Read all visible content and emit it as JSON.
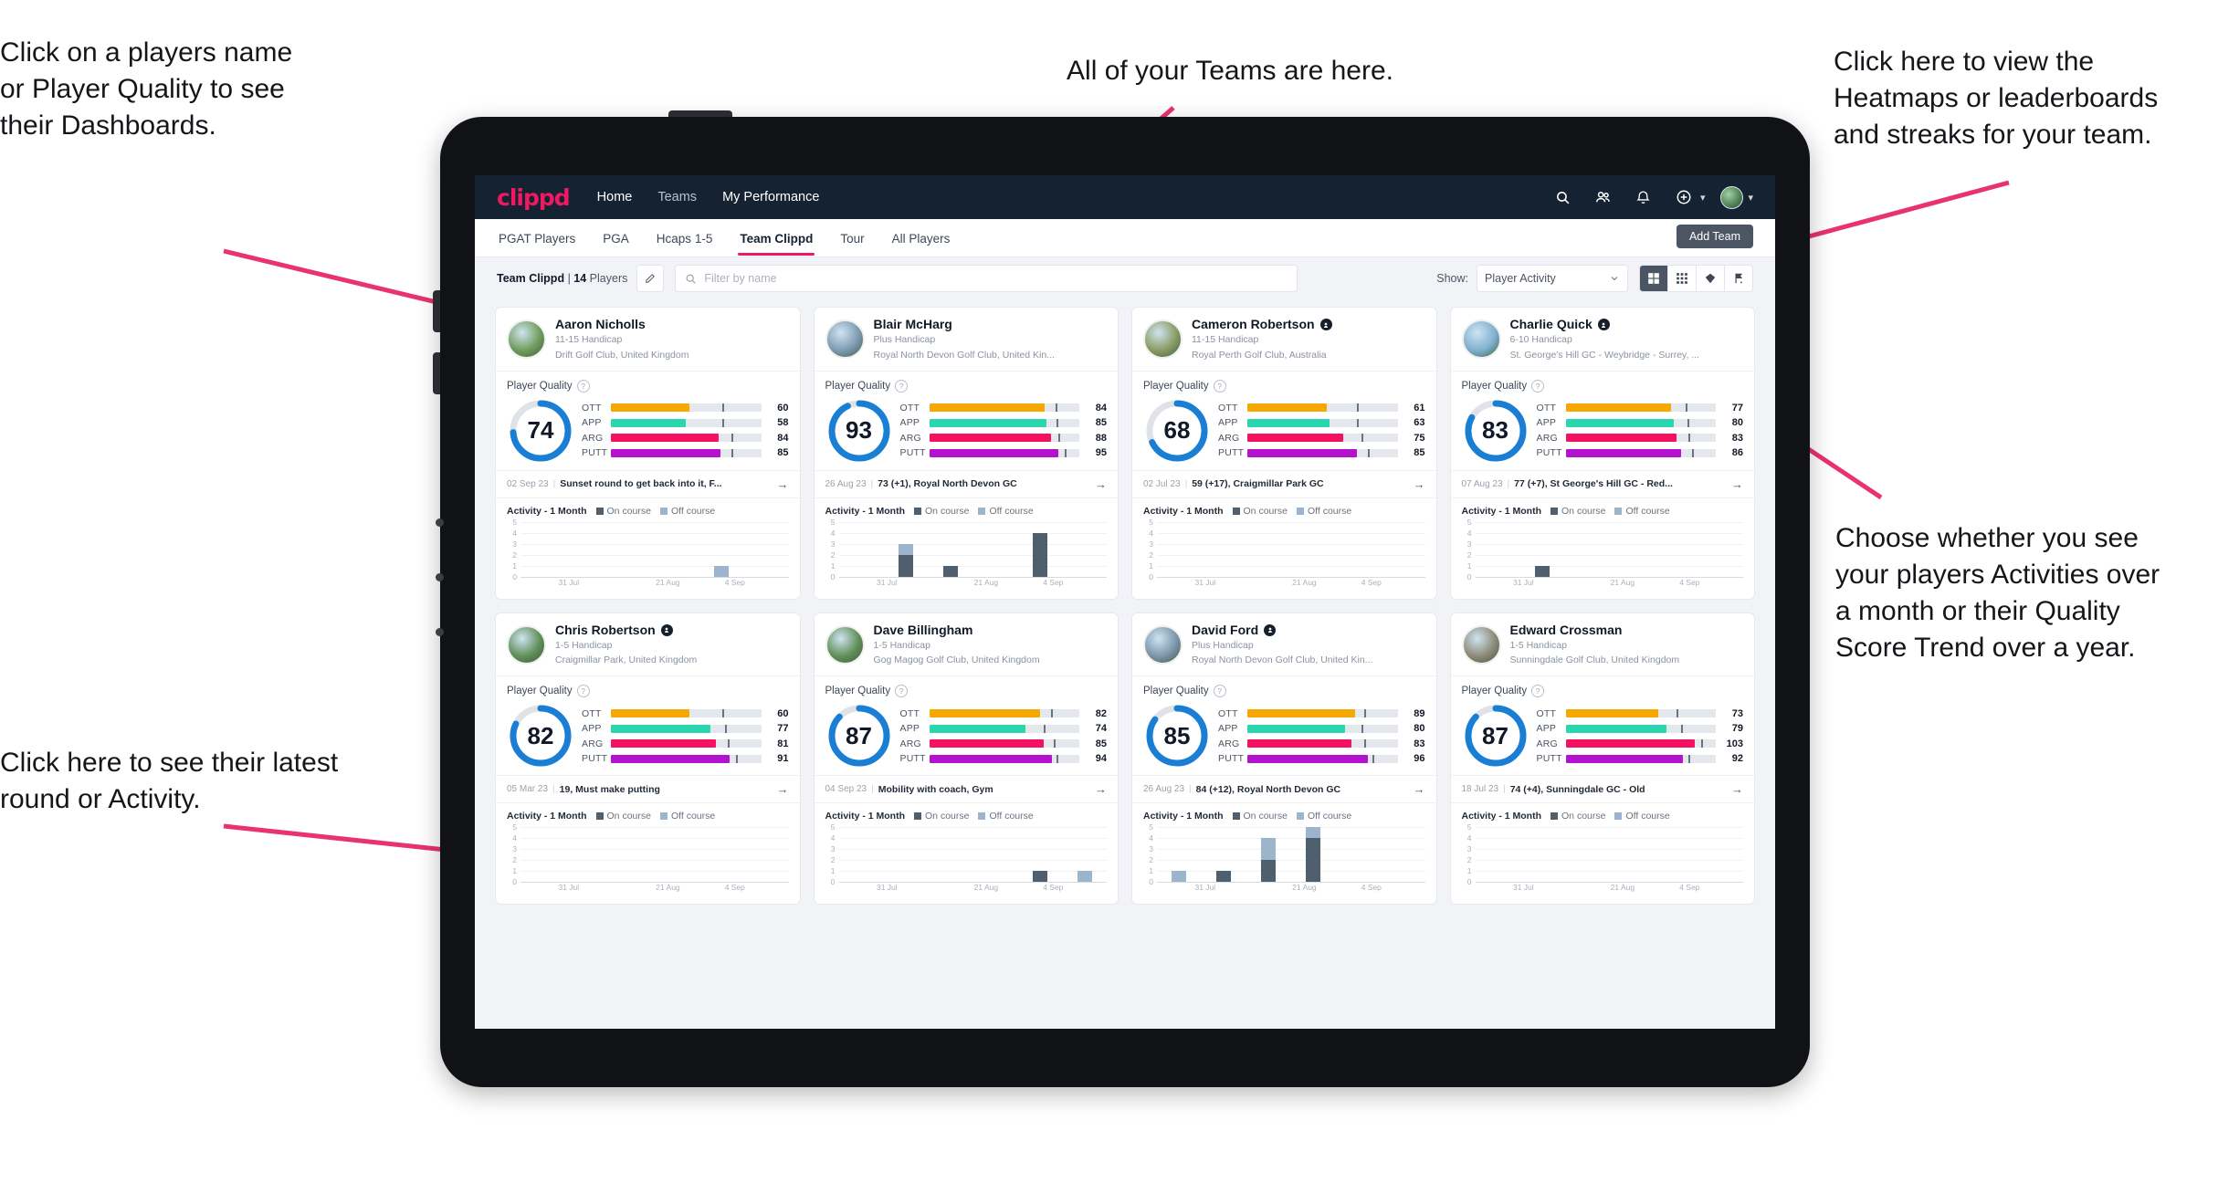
{
  "annotations": {
    "teams": "All of your Teams are here.",
    "heatmaps": "Click here to view the\nHeatmaps or leaderboards\nand streaks for your team.",
    "players_name": "Click on a players name\nor Player Quality to see\ntheir Dashboards.",
    "choose": "Choose whether you see\nyour players Activities over\na month or their Quality\nScore Trend over a year.",
    "latest_round": "Click here to see their latest\nround or Activity."
  },
  "topnav": {
    "brand": "clippd",
    "links": [
      {
        "label": "Home",
        "active": true
      },
      {
        "label": "Teams",
        "active": false
      },
      {
        "label": "My Performance",
        "active": true
      }
    ],
    "icons": [
      "search-icon",
      "people-icon",
      "bell-icon",
      "plus-circle-icon",
      "avatar"
    ]
  },
  "tabs": [
    {
      "label": "PGAT Players",
      "active": false
    },
    {
      "label": "PGA",
      "active": false
    },
    {
      "label": "Hcaps 1-5",
      "active": false
    },
    {
      "label": "Team Clippd",
      "active": true
    },
    {
      "label": "Tour",
      "active": false
    },
    {
      "label": "All Players",
      "active": false
    }
  ],
  "add_team_label": "Add Team",
  "filterbar": {
    "team_name": "Team Clippd",
    "team_divider": " | ",
    "player_count": "14",
    "players_word": " Players",
    "edit_icon": "pencil-icon",
    "search_placeholder": "Filter by name",
    "show_label": "Show:",
    "show_value": "Player Activity",
    "views": [
      {
        "name": "grid-large-view",
        "active": true
      },
      {
        "name": "grid-small-view",
        "active": false
      },
      {
        "name": "heatmap-view",
        "active": false
      },
      {
        "name": "leaderboard-view",
        "active": false
      }
    ]
  },
  "card_labels": {
    "player_quality": "Player Quality",
    "activity_title": "Activity - 1 Month",
    "legend_on": "On course",
    "legend_off": "Off course",
    "metrics": [
      "OTT",
      "APP",
      "ARG",
      "PUTT"
    ],
    "x_ticks": [
      "31 Jul",
      "21 Aug",
      "4 Sep"
    ],
    "y_ticks": [
      "5",
      "4",
      "3",
      "2",
      "1",
      "0"
    ]
  },
  "colors": {
    "brand": "#ef1862",
    "navbar": "#152232",
    "ott": "#f5a800",
    "app": "#2ad6ae",
    "arg": "#f5115f",
    "putt": "#b312cf",
    "ring": "#1a7fd4",
    "on_course": "#4f5f6e",
    "off_course": "#9cb4cc",
    "annotation_arrow": "#e8336d"
  },
  "players": [
    {
      "name": "Aaron Nicholls",
      "verified": false,
      "handicap": "11-15 Handicap",
      "club": "Drift Golf Club, United Kingdom",
      "avatar": "#6f9c5a",
      "quality": 74,
      "metrics": [
        {
          "label": "OTT",
          "value": 60,
          "fill": 52,
          "tick": 74
        },
        {
          "label": "APP",
          "value": 58,
          "fill": 50,
          "tick": 74
        },
        {
          "label": "ARG",
          "value": 84,
          "fill": 72,
          "tick": 80
        },
        {
          "label": "PUTT",
          "value": 85,
          "fill": 73,
          "tick": 80
        }
      ],
      "round_date": "02 Sep 23",
      "round_text": "Sunset round to get back into it, F...",
      "activity": [
        {
          "on": 0,
          "off": 0
        },
        {
          "on": 0,
          "off": 0
        },
        {
          "on": 0,
          "off": 0
        },
        {
          "on": 0,
          "off": 0
        },
        {
          "on": 0,
          "off": 1
        },
        {
          "on": 0,
          "off": 0
        }
      ]
    },
    {
      "name": "Blair McHarg",
      "verified": false,
      "handicap": "Plus Handicap",
      "club": "Royal North Devon Golf Club, United Kin...",
      "avatar": "#7e9ab0",
      "quality": 93,
      "metrics": [
        {
          "label": "OTT",
          "value": 84,
          "fill": 77,
          "tick": 84
        },
        {
          "label": "APP",
          "value": 85,
          "fill": 78,
          "tick": 85
        },
        {
          "label": "ARG",
          "value": 88,
          "fill": 81,
          "tick": 86
        },
        {
          "label": "PUTT",
          "value": 95,
          "fill": 86,
          "tick": 90
        }
      ],
      "round_date": "26 Aug 23",
      "round_text": "73 (+1), Royal North Devon GC",
      "activity": [
        {
          "on": 0,
          "off": 0
        },
        {
          "on": 2,
          "off": 1
        },
        {
          "on": 1,
          "off": 0
        },
        {
          "on": 0,
          "off": 0
        },
        {
          "on": 4,
          "off": 0
        },
        {
          "on": 0,
          "off": 0
        }
      ]
    },
    {
      "name": "Cameron Robertson",
      "verified": true,
      "handicap": "11-15 Handicap",
      "club": "Royal Perth Golf Club, Australia",
      "avatar": "#8a9b63",
      "quality": 68,
      "metrics": [
        {
          "label": "OTT",
          "value": 61,
          "fill": 53,
          "tick": 73
        },
        {
          "label": "APP",
          "value": 63,
          "fill": 55,
          "tick": 73
        },
        {
          "label": "ARG",
          "value": 75,
          "fill": 64,
          "tick": 76
        },
        {
          "label": "PUTT",
          "value": 85,
          "fill": 73,
          "tick": 80
        }
      ],
      "round_date": "02 Jul 23",
      "round_text": "59 (+17), Craigmillar Park GC",
      "activity": [
        {
          "on": 0,
          "off": 0
        },
        {
          "on": 0,
          "off": 0
        },
        {
          "on": 0,
          "off": 0
        },
        {
          "on": 0,
          "off": 0
        },
        {
          "on": 0,
          "off": 0
        },
        {
          "on": 0,
          "off": 0
        }
      ]
    },
    {
      "name": "Charlie Quick",
      "verified": true,
      "handicap": "6-10 Handicap",
      "club": "St. George's Hill GC - Weybridge - Surrey, ...",
      "avatar": "#7fb0cf",
      "quality": 83,
      "metrics": [
        {
          "label": "OTT",
          "value": 77,
          "fill": 70,
          "tick": 80
        },
        {
          "label": "APP",
          "value": 80,
          "fill": 72,
          "tick": 81
        },
        {
          "label": "ARG",
          "value": 83,
          "fill": 74,
          "tick": 82
        },
        {
          "label": "PUTT",
          "value": 86,
          "fill": 77,
          "tick": 84
        }
      ],
      "round_date": "07 Aug 23",
      "round_text": "77 (+7), St George's Hill GC - Red...",
      "activity": [
        {
          "on": 0,
          "off": 0
        },
        {
          "on": 1,
          "off": 0
        },
        {
          "on": 0,
          "off": 0
        },
        {
          "on": 0,
          "off": 0
        },
        {
          "on": 0,
          "off": 0
        },
        {
          "on": 0,
          "off": 0
        }
      ]
    },
    {
      "name": "Chris Robertson",
      "verified": true,
      "handicap": "1-5 Handicap",
      "club": "Craigmillar Park, United Kingdom",
      "avatar": "#5f8f57",
      "quality": 82,
      "metrics": [
        {
          "label": "OTT",
          "value": 60,
          "fill": 52,
          "tick": 74
        },
        {
          "label": "APP",
          "value": 77,
          "fill": 66,
          "tick": 76
        },
        {
          "label": "ARG",
          "value": 81,
          "fill": 70,
          "tick": 78
        },
        {
          "label": "PUTT",
          "value": 91,
          "fill": 79,
          "tick": 83
        }
      ],
      "round_date": "05 Mar 23",
      "round_text": "19, Must make putting",
      "activity": [
        {
          "on": 0,
          "off": 0
        },
        {
          "on": 0,
          "off": 0
        },
        {
          "on": 0,
          "off": 0
        },
        {
          "on": 0,
          "off": 0
        },
        {
          "on": 0,
          "off": 0
        },
        {
          "on": 0,
          "off": 0
        }
      ]
    },
    {
      "name": "Dave Billingham",
      "verified": false,
      "handicap": "1-5 Handicap",
      "club": "Gog Magog Golf Club, United Kingdom",
      "avatar": "#5f8f57",
      "quality": 87,
      "metrics": [
        {
          "label": "OTT",
          "value": 82,
          "fill": 74,
          "tick": 81
        },
        {
          "label": "APP",
          "value": 74,
          "fill": 64,
          "tick": 76
        },
        {
          "label": "ARG",
          "value": 85,
          "fill": 76,
          "tick": 83
        },
        {
          "label": "PUTT",
          "value": 94,
          "fill": 82,
          "tick": 85
        }
      ],
      "round_date": "04 Sep 23",
      "round_text": "Mobility with coach, Gym",
      "activity": [
        {
          "on": 0,
          "off": 0
        },
        {
          "on": 0,
          "off": 0
        },
        {
          "on": 0,
          "off": 0
        },
        {
          "on": 0,
          "off": 0
        },
        {
          "on": 1,
          "off": 0
        },
        {
          "on": 0,
          "off": 1
        }
      ]
    },
    {
      "name": "David Ford",
      "verified": true,
      "handicap": "Plus Handicap",
      "club": "Royal North Devon Golf Club, United Kin...",
      "avatar": "#7c95aa",
      "quality": 85,
      "metrics": [
        {
          "label": "OTT",
          "value": 89,
          "fill": 72,
          "tick": 78
        },
        {
          "label": "APP",
          "value": 80,
          "fill": 65,
          "tick": 76
        },
        {
          "label": "ARG",
          "value": 83,
          "fill": 69,
          "tick": 78
        },
        {
          "label": "PUTT",
          "value": 96,
          "fill": 80,
          "tick": 83
        }
      ],
      "round_date": "26 Aug 23",
      "round_text": "84 (+12), Royal North Devon GC",
      "activity": [
        {
          "on": 0,
          "off": 1
        },
        {
          "on": 1,
          "off": 0
        },
        {
          "on": 2,
          "off": 2
        },
        {
          "on": 4,
          "off": 1
        },
        {
          "on": 0,
          "off": 0
        },
        {
          "on": 0,
          "off": 0
        }
      ]
    },
    {
      "name": "Edward Crossman",
      "verified": false,
      "handicap": "1-5 Handicap",
      "club": "Sunningdale Golf Club, United Kingdom",
      "avatar": "#8e8a78",
      "quality": 87,
      "metrics": [
        {
          "label": "OTT",
          "value": 73,
          "fill": 62,
          "tick": 74
        },
        {
          "label": "APP",
          "value": 79,
          "fill": 67,
          "tick": 77
        },
        {
          "label": "ARG",
          "value": 103,
          "fill": 86,
          "tick": 90
        },
        {
          "label": "PUTT",
          "value": 92,
          "fill": 78,
          "tick": 82
        }
      ],
      "round_date": "18 Jul 23",
      "round_text": "74 (+4), Sunningdale GC - Old",
      "activity": [
        {
          "on": 0,
          "off": 0
        },
        {
          "on": 0,
          "off": 0
        },
        {
          "on": 0,
          "off": 0
        },
        {
          "on": 0,
          "off": 0
        },
        {
          "on": 0,
          "off": 0
        },
        {
          "on": 0,
          "off": 0
        }
      ]
    }
  ]
}
